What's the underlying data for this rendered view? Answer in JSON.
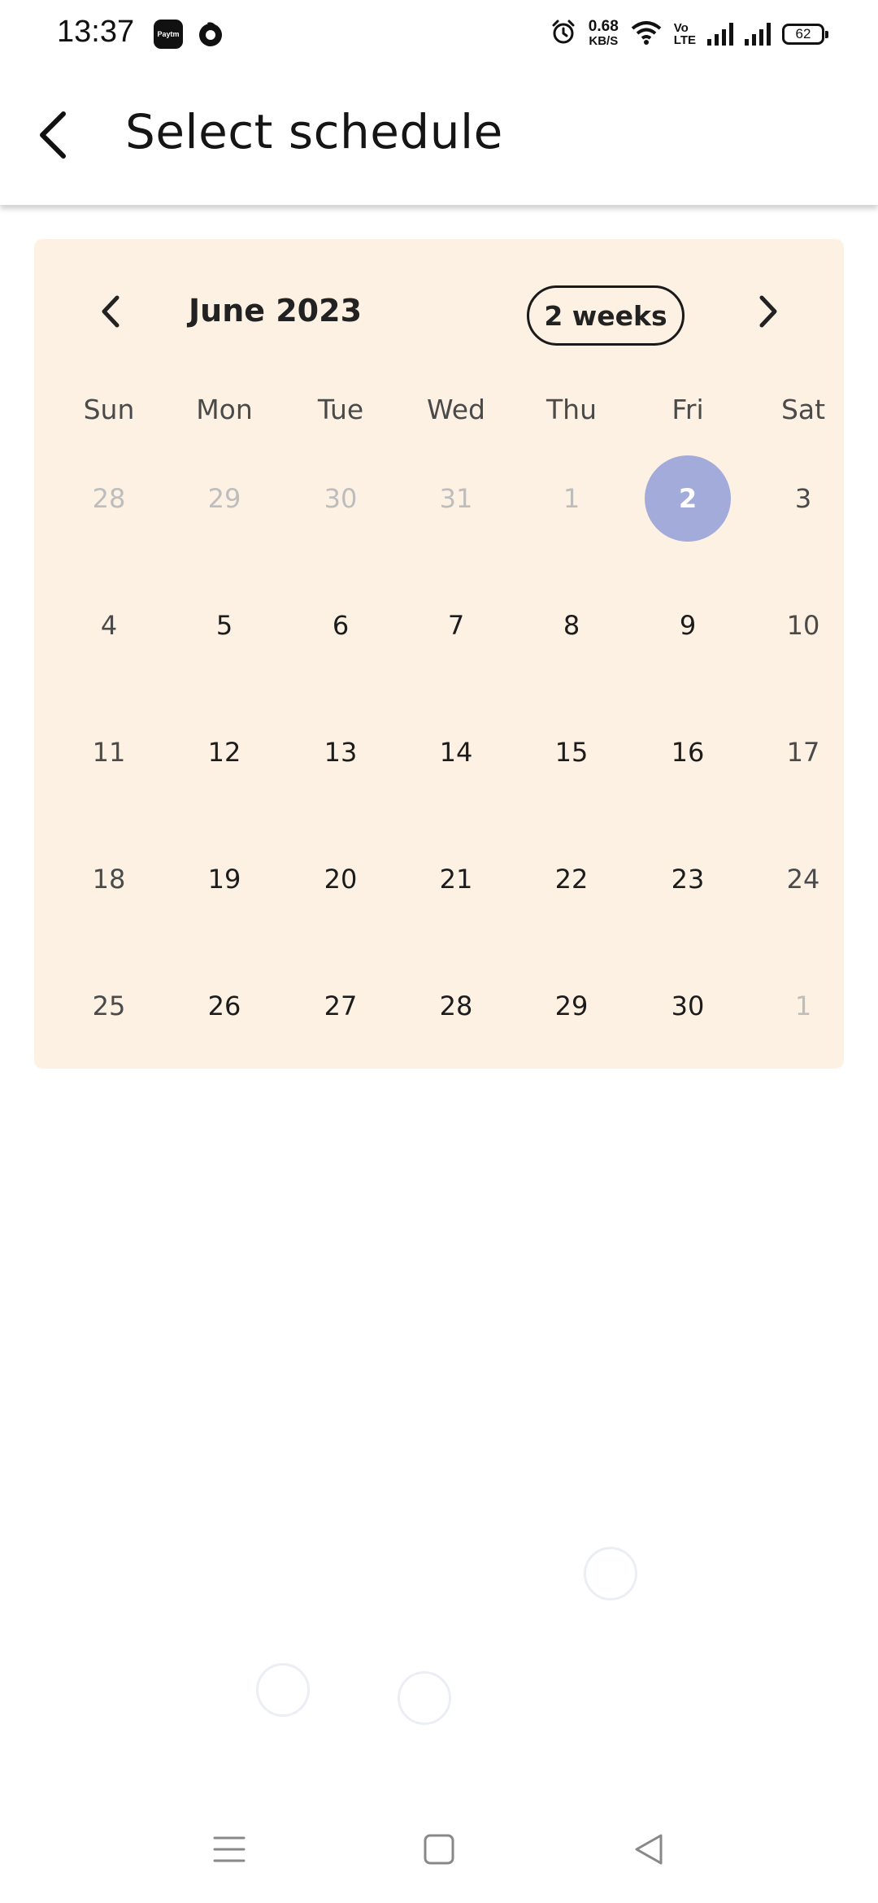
{
  "status_bar": {
    "time": "13:37",
    "paytm_label": "Paytm",
    "speed_value": "0.68",
    "speed_unit": "KB/S",
    "volte_line1": "Vo",
    "volte_line2": "LTE",
    "battery": "62",
    "icons": [
      "paytm-icon",
      "firefox-icon",
      "alarm-icon",
      "wifi-icon",
      "signal-icon",
      "signal-icon",
      "battery-icon"
    ]
  },
  "app_bar": {
    "title": "Select schedule",
    "back_icon": "arrow-left-icon"
  },
  "calendar": {
    "month_label": "June 2023",
    "format_button": "2 weeks",
    "prev_icon": "chevron-left-icon",
    "next_icon": "chevron-right-icon",
    "selected_color": "#a2abd9",
    "background_color": "#fdf1e3",
    "weekdays": [
      "Sun",
      "Mon",
      "Tue",
      "Wed",
      "Thu",
      "Fri",
      "Sat"
    ],
    "weeks": [
      [
        "28",
        "29",
        "30",
        "31",
        "1",
        "2",
        "3"
      ],
      [
        "4",
        "5",
        "6",
        "7",
        "8",
        "9",
        "10"
      ],
      [
        "11",
        "12",
        "13",
        "14",
        "15",
        "16",
        "17"
      ],
      [
        "18",
        "19",
        "20",
        "21",
        "22",
        "23",
        "24"
      ],
      [
        "25",
        "26",
        "27",
        "28",
        "29",
        "30",
        "1"
      ]
    ],
    "selected_day": "2",
    "outside_month_days": [
      "28",
      "29",
      "30",
      "31",
      "1",
      "1"
    ]
  },
  "system_nav": {
    "icons": [
      "menu-icon",
      "home-icon",
      "back-icon"
    ]
  }
}
